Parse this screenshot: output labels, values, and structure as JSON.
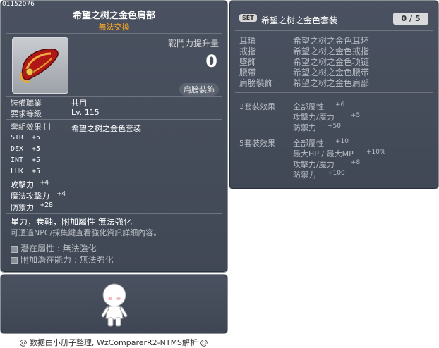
{
  "item": {
    "id": "01152076",
    "name": "希望之树之金色肩部",
    "trade": "無法交換",
    "power_label": "戰鬥力提升量",
    "power_value": "0",
    "category": "肩膀裝飾",
    "job_label": "裝備職業",
    "job_value": "共用",
    "level_label": "要求等級",
    "level_value": "Lv. 115",
    "set_label": "套組效果",
    "set_name": "希望之树之金色套装",
    "stats": [
      {
        "name": "STR",
        "value": "+5"
      },
      {
        "name": "DEX",
        "value": "+5"
      },
      {
        "name": "INT",
        "value": "+5"
      },
      {
        "name": "LUK",
        "value": "+5"
      },
      {
        "name": "攻擊力",
        "value": "+4"
      },
      {
        "name": "魔法攻擊力",
        "value": "+4"
      },
      {
        "name": "防禦力",
        "value": "+28"
      }
    ],
    "note1": "星力，卷軸，附加屬性 無法強化",
    "note2": "可透過NPC/採集鍵查看強化資訊詳細內容。",
    "potential": "潛在屬性 : 無法強化",
    "bonus_potential": "附加潛在能力 : 無法強化"
  },
  "set": {
    "badge": "SET",
    "name": "希望之树之金色套装",
    "count": "0 / 5",
    "parts": [
      {
        "slot": "耳環",
        "name": "希望之树之金色耳环"
      },
      {
        "slot": "戒指",
        "name": "希望之树之金色戒指"
      },
      {
        "slot": "墜飾",
        "name": "希望之树之金色项链"
      },
      {
        "slot": "腰帶",
        "name": "希望之树之金色腰带"
      },
      {
        "slot": "肩膀裝飾",
        "name": "希望之树之金色肩部"
      }
    ],
    "effect3_label": "3套裝效果",
    "effect3": [
      {
        "name": "全部屬性",
        "value": "+6"
      },
      {
        "name": "攻擊力/魔力",
        "value": "+5"
      },
      {
        "name": "防禦力",
        "value": "+50"
      }
    ],
    "effect5_label": "5套裝效果",
    "effect5": [
      {
        "name": "全部屬性",
        "value": "+10"
      },
      {
        "name": "最大HP / 最大MP",
        "value": "+10%"
      },
      {
        "name": "攻擊力/魔力",
        "value": "+8"
      },
      {
        "name": "防禦力",
        "value": "+100"
      }
    ]
  },
  "footer": "@ 数据由小册子整理, WzComparerR2-NTMS解析 @",
  "colors": {
    "panel": "#444b58",
    "trade": "#ffaa22",
    "item_red": "#c0201a"
  }
}
